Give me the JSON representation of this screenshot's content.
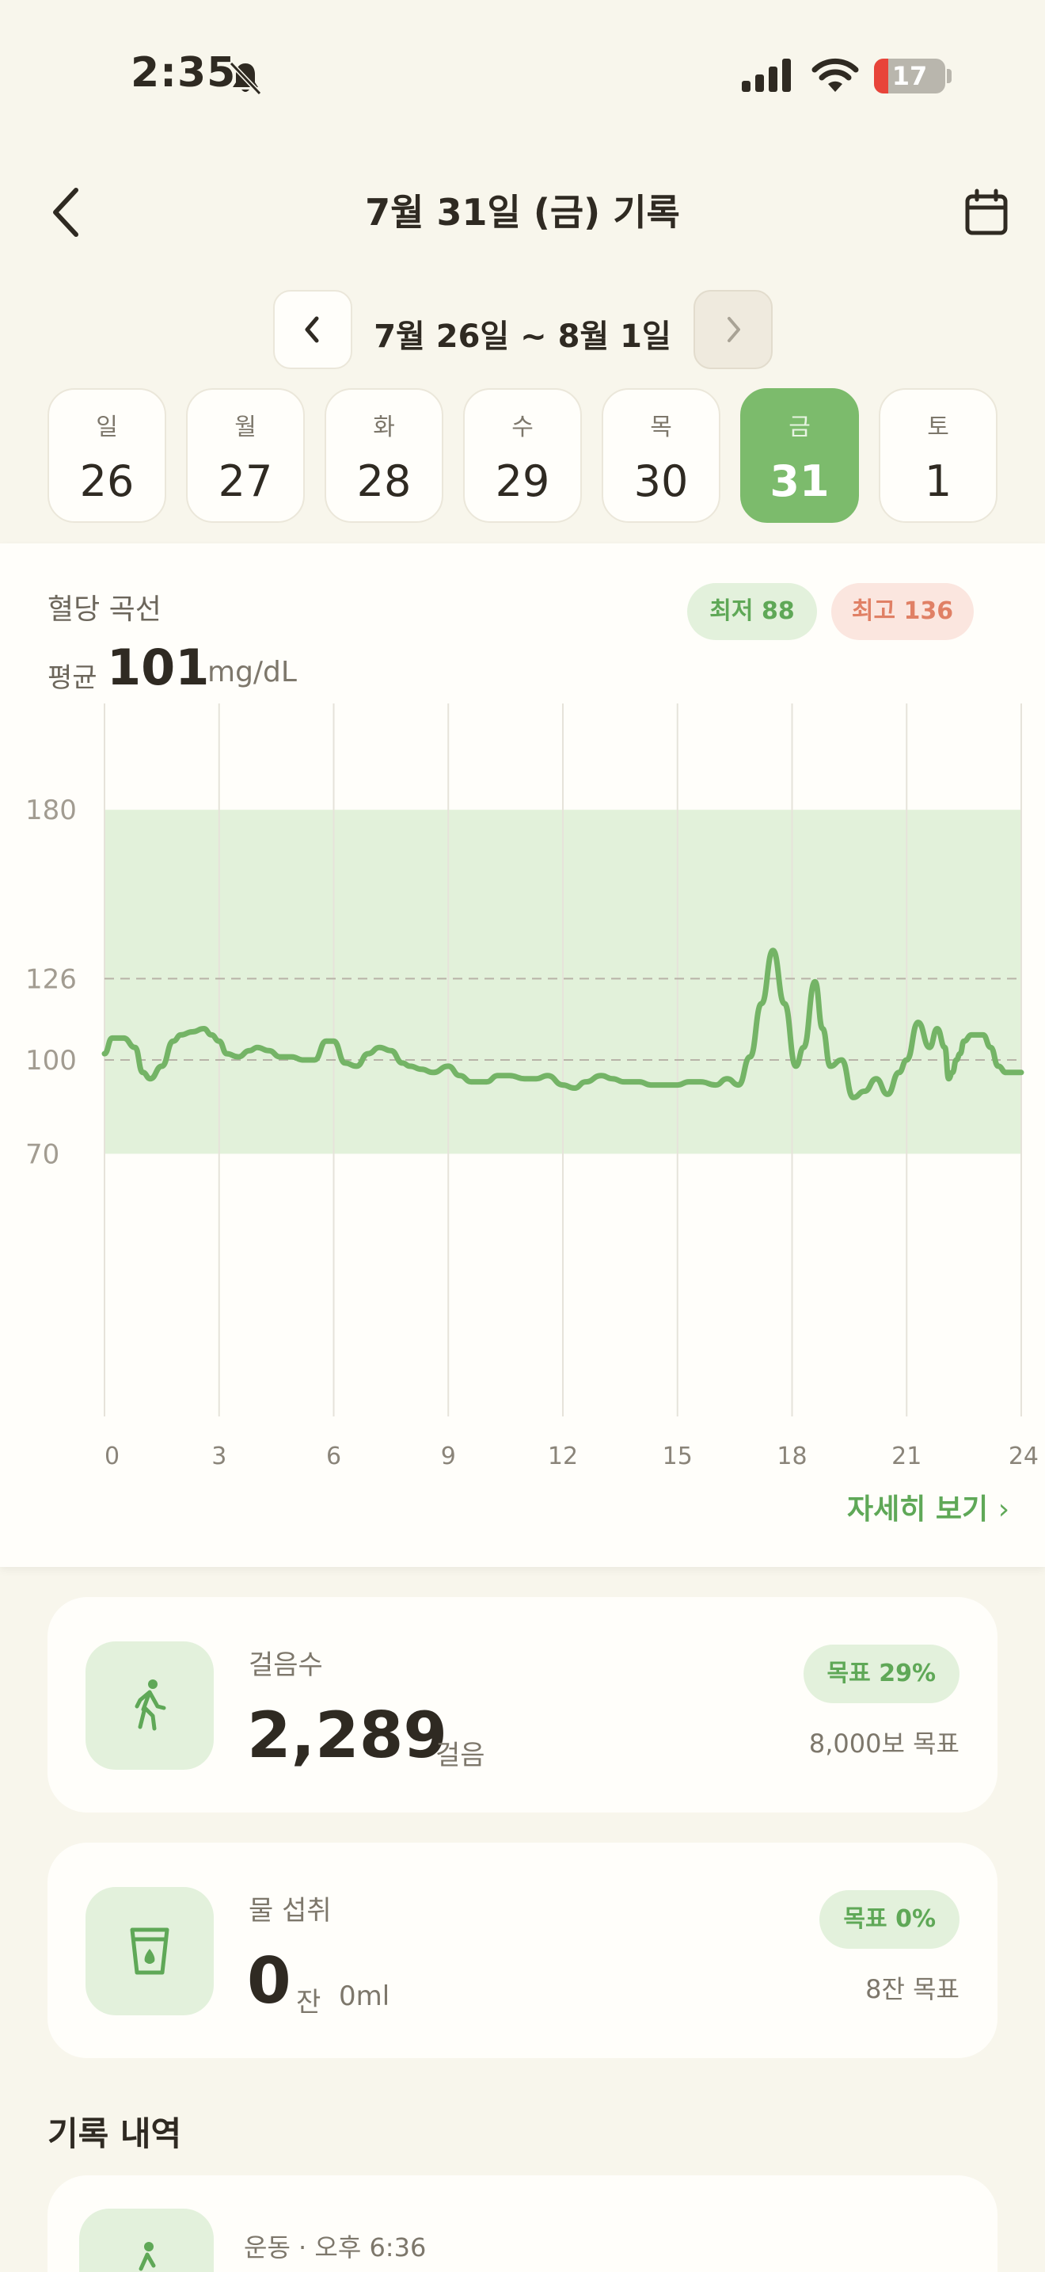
{
  "status_bar": {
    "time": "2:35",
    "battery": "17"
  },
  "header": {
    "title": "7월 31일 (금) 기록"
  },
  "week": {
    "range": "7월 26일 ~ 8월 1일",
    "days": [
      {
        "dow": "일",
        "num": "26",
        "active": false
      },
      {
        "dow": "월",
        "num": "27",
        "active": false
      },
      {
        "dow": "화",
        "num": "28",
        "active": false
      },
      {
        "dow": "수",
        "num": "29",
        "active": false
      },
      {
        "dow": "목",
        "num": "30",
        "active": false
      },
      {
        "dow": "금",
        "num": "31",
        "active": true
      },
      {
        "dow": "토",
        "num": "1",
        "active": false
      }
    ]
  },
  "glucose": {
    "title": "혈당 곡선",
    "min_badge": "최저 88",
    "max_badge": "최고 136",
    "avg_label": "평균",
    "avg_value": "101",
    "avg_unit": "mg/dL",
    "detail_link": "자세히 보기"
  },
  "chart_data": {
    "type": "line",
    "title": "",
    "xlabel": "",
    "ylabel": "",
    "x_ticks": [
      "0",
      "3",
      "6",
      "9",
      "12",
      "15",
      "18",
      "21",
      "24"
    ],
    "y_ticks": [
      "180",
      "126",
      "100",
      "70"
    ],
    "target_range": [
      70,
      180
    ],
    "reference_lines": [
      126,
      100
    ],
    "xlim": [
      0,
      24
    ],
    "ylim": [
      -14,
      214
    ],
    "series": [
      {
        "color": "#74b466",
        "x": [
          0,
          0.2,
          0.5,
          0.8,
          1.0,
          1.2,
          1.5,
          1.8,
          2.0,
          2.3,
          2.6,
          2.8,
          3.0,
          3.2,
          3.5,
          3.8,
          4.0,
          4.3,
          4.6,
          4.9,
          5.2,
          5.5,
          5.8,
          6.0,
          6.3,
          6.6,
          6.9,
          7.2,
          7.5,
          7.8,
          8.0,
          8.3,
          8.6,
          9.0,
          9.3,
          9.6,
          10.0,
          10.3,
          10.6,
          11.0,
          11.3,
          11.6,
          12.0,
          12.3,
          12.6,
          13.0,
          13.3,
          13.6,
          14.0,
          14.3,
          14.6,
          15.0,
          15.3,
          15.6,
          16.0,
          16.3,
          16.6,
          16.9,
          17.2,
          17.5,
          17.8,
          18.1,
          18.3,
          18.6,
          18.8,
          19.0,
          19.3,
          19.6,
          19.9,
          20.2,
          20.5,
          20.8,
          21.0,
          21.3,
          21.6,
          21.8,
          22.0,
          22.1,
          22.2,
          22.3,
          22.4,
          22.5,
          22.7,
          23.0,
          23.2,
          23.4,
          23.6,
          23.8,
          24.0
        ],
        "values": [
          102,
          107,
          107,
          104,
          96,
          94,
          98,
          106,
          108,
          109,
          110,
          108,
          106,
          102,
          101,
          103,
          104,
          103,
          101,
          101,
          100,
          100,
          106,
          106,
          99,
          98,
          102,
          104,
          103,
          99,
          98,
          97,
          96,
          98,
          95,
          93,
          93,
          95,
          95,
          94,
          94,
          95,
          92,
          91,
          93,
          95,
          94,
          93,
          93,
          92,
          92,
          92,
          93,
          93,
          92,
          94,
          92,
          101,
          118,
          135,
          118,
          98,
          104,
          125,
          110,
          98,
          100,
          88,
          90,
          94,
          89,
          96,
          100,
          112,
          104,
          110,
          104,
          94,
          96,
          100,
          102,
          106,
          108,
          108,
          104,
          98,
          96,
          96,
          96
        ]
      }
    ],
    "grid": true
  },
  "steps": {
    "label": "걸음수",
    "value": "2,289",
    "unit": "걸음",
    "badge": "목표 29%",
    "goal": "8,000보 목표"
  },
  "water": {
    "label": "물 섭취",
    "value": "0",
    "unit": "잔",
    "ml": "0ml",
    "badge": "목표 0%",
    "goal": "8잔 목표"
  },
  "records": {
    "section_title": "기록 내역",
    "items": [
      {
        "meta": "운동 · 오후 6:36"
      }
    ]
  }
}
